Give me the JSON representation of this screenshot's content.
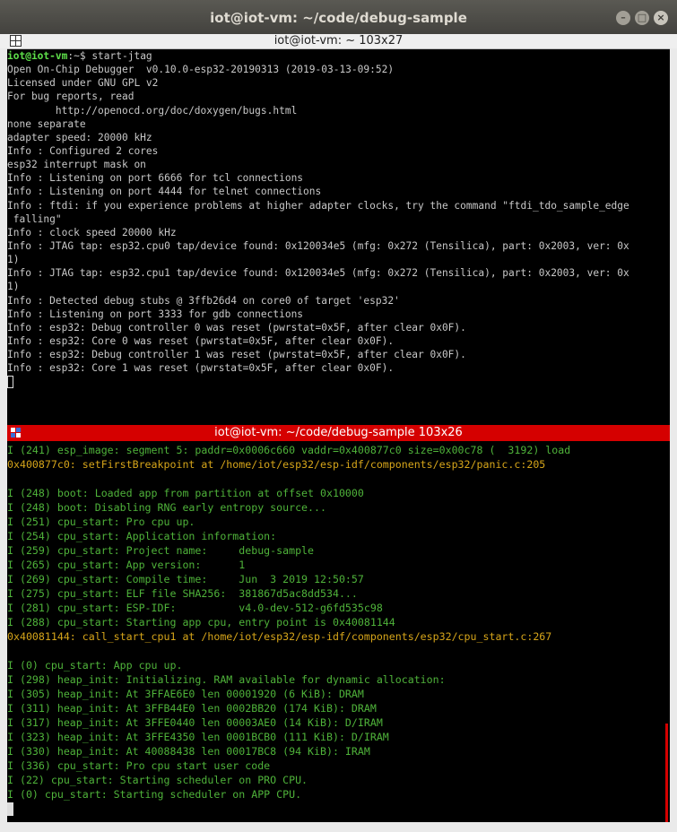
{
  "window": {
    "title": "iot@iot-vm: ~/code/debug-sample",
    "buttons": [
      "–",
      "□",
      "×"
    ]
  },
  "tab": {
    "title": "iot@iot-vm: ~ 103x27"
  },
  "pane_divider": {
    "title": "iot@iot-vm: ~/code/debug-sample 103x26",
    "accent": "#d50000"
  },
  "pane1": {
    "prompt_user": "iot@iot-vm",
    "prompt_path": ":~$",
    "command": " start-jtag",
    "lines": [
      "Open On-Chip Debugger  v0.10.0-esp32-20190313 (2019-03-13-09:52)",
      "Licensed under GNU GPL v2",
      "For bug reports, read",
      "        http://openocd.org/doc/doxygen/bugs.html",
      "none separate",
      "adapter speed: 20000 kHz",
      "Info : Configured 2 cores",
      "esp32 interrupt mask on",
      "Info : Listening on port 6666 for tcl connections",
      "Info : Listening on port 4444 for telnet connections",
      "Info : ftdi: if you experience problems at higher adapter clocks, try the command \"ftdi_tdo_sample_edge",
      " falling\"",
      "Info : clock speed 20000 kHz",
      "Info : JTAG tap: esp32.cpu0 tap/device found: 0x120034e5 (mfg: 0x272 (Tensilica), part: 0x2003, ver: 0x",
      "1)",
      "Info : JTAG tap: esp32.cpu1 tap/device found: 0x120034e5 (mfg: 0x272 (Tensilica), part: 0x2003, ver: 0x",
      "1)",
      "Info : Detected debug stubs @ 3ffb26d4 on core0 of target 'esp32'",
      "Info : Listening on port 3333 for gdb connections",
      "Info : esp32: Debug controller 0 was reset (pwrstat=0x5F, after clear 0x0F).",
      "Info : esp32: Core 0 was reset (pwrstat=0x5F, after clear 0x0F).",
      "Info : esp32: Debug controller 1 was reset (pwrstat=0x5F, after clear 0x0F).",
      "Info : esp32: Core 1 was reset (pwrstat=0x5F, after clear 0x0F)."
    ]
  },
  "pane2": {
    "lines": [
      {
        "t": "I (241) esp_image: segment 5: paddr=0x0006c660 vaddr=0x400877c0 size=0x00c78 (  3192) load",
        "c": "green"
      },
      {
        "t": "0x400877c0: setFirstBreakpoint at /home/iot/esp32/esp-idf/components/esp32/panic.c:205",
        "c": "yellow"
      },
      {
        "t": "",
        "c": "green"
      },
      {
        "t": "I (248) boot: Loaded app from partition at offset 0x10000",
        "c": "green"
      },
      {
        "t": "I (248) boot: Disabling RNG early entropy source...",
        "c": "green"
      },
      {
        "t": "I (251) cpu_start: Pro cpu up.",
        "c": "green"
      },
      {
        "t": "I (254) cpu_start: Application information:",
        "c": "green"
      },
      {
        "t": "I (259) cpu_start: Project name:     debug-sample",
        "c": "green"
      },
      {
        "t": "I (265) cpu_start: App version:      1",
        "c": "green"
      },
      {
        "t": "I (269) cpu_start: Compile time:     Jun  3 2019 12:50:57",
        "c": "green"
      },
      {
        "t": "I (275) cpu_start: ELF file SHA256:  381867d5ac8dd534...",
        "c": "green"
      },
      {
        "t": "I (281) cpu_start: ESP-IDF:          v4.0-dev-512-g6fd535c98",
        "c": "green"
      },
      {
        "t": "I (288) cpu_start: Starting app cpu, entry point is 0x40081144",
        "c": "green"
      },
      {
        "t": "0x40081144: call_start_cpu1 at /home/iot/esp32/esp-idf/components/esp32/cpu_start.c:267",
        "c": "yellow"
      },
      {
        "t": "",
        "c": "green"
      },
      {
        "t": "I (0) cpu_start: App cpu up.",
        "c": "green"
      },
      {
        "t": "I (298) heap_init: Initializing. RAM available for dynamic allocation:",
        "c": "green"
      },
      {
        "t": "I (305) heap_init: At 3FFAE6E0 len 00001920 (6 KiB): DRAM",
        "c": "green"
      },
      {
        "t": "I (311) heap_init: At 3FFB44E0 len 0002BB20 (174 KiB): DRAM",
        "c": "green"
      },
      {
        "t": "I (317) heap_init: At 3FFE0440 len 00003AE0 (14 KiB): D/IRAM",
        "c": "green"
      },
      {
        "t": "I (323) heap_init: At 3FFE4350 len 0001BCB0 (111 KiB): D/IRAM",
        "c": "green"
      },
      {
        "t": "I (330) heap_init: At 40088438 len 00017BC8 (94 KiB): IRAM",
        "c": "green"
      },
      {
        "t": "I (336) cpu_start: Pro cpu start user code",
        "c": "green"
      },
      {
        "t": "I (22) cpu_start: Starting scheduler on PRO CPU.",
        "c": "green"
      },
      {
        "t": "I (0) cpu_start: Starting scheduler on APP CPU.",
        "c": "green"
      }
    ]
  }
}
